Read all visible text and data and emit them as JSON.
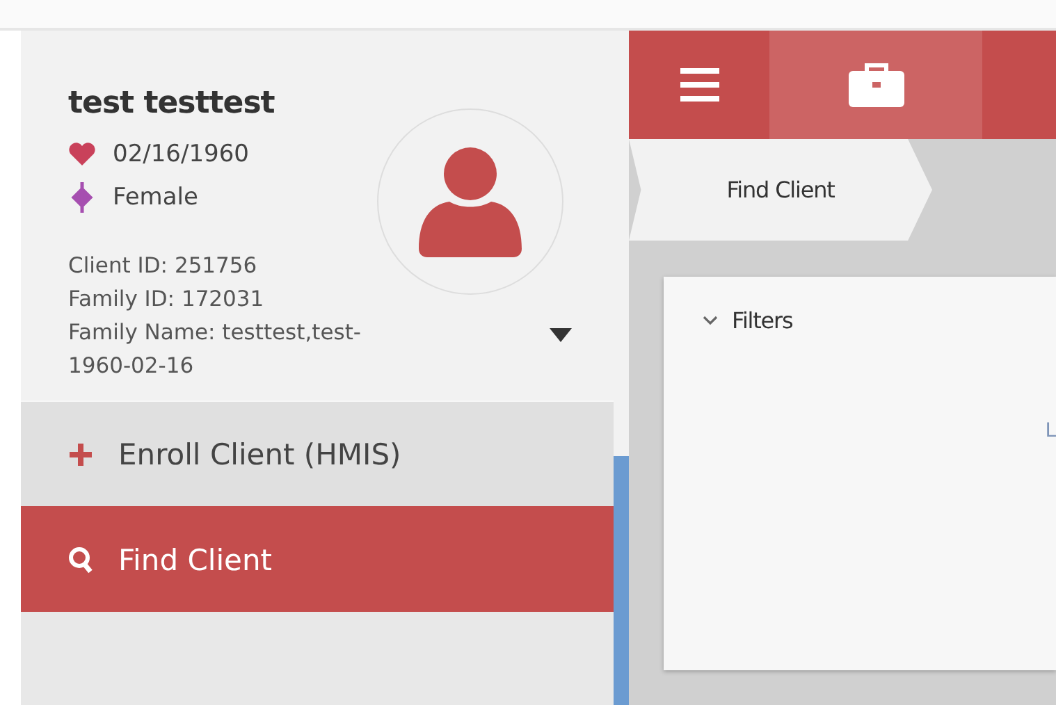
{
  "client": {
    "name": "test testtest",
    "birth_date": "02/16/1960",
    "gender": "Female",
    "client_id": "Client ID: 251756",
    "family_id": "Family ID: 172031",
    "family_name": "Family Name: testtest,test-1960-02-16"
  },
  "sidebar": {
    "items": [
      {
        "label": "Enroll Client (HMIS)",
        "kind": "plus",
        "selected": false
      },
      {
        "label": "Find Client",
        "kind": "search",
        "selected": true
      }
    ]
  },
  "toolbar": {
    "tabs": [
      {
        "kind": "menu",
        "selected": false
      },
      {
        "kind": "briefcase",
        "selected": true
      }
    ]
  },
  "breadcrumb": "Find Client",
  "panel": {
    "section": "Filters",
    "expanded": true,
    "cut_text": "L"
  }
}
